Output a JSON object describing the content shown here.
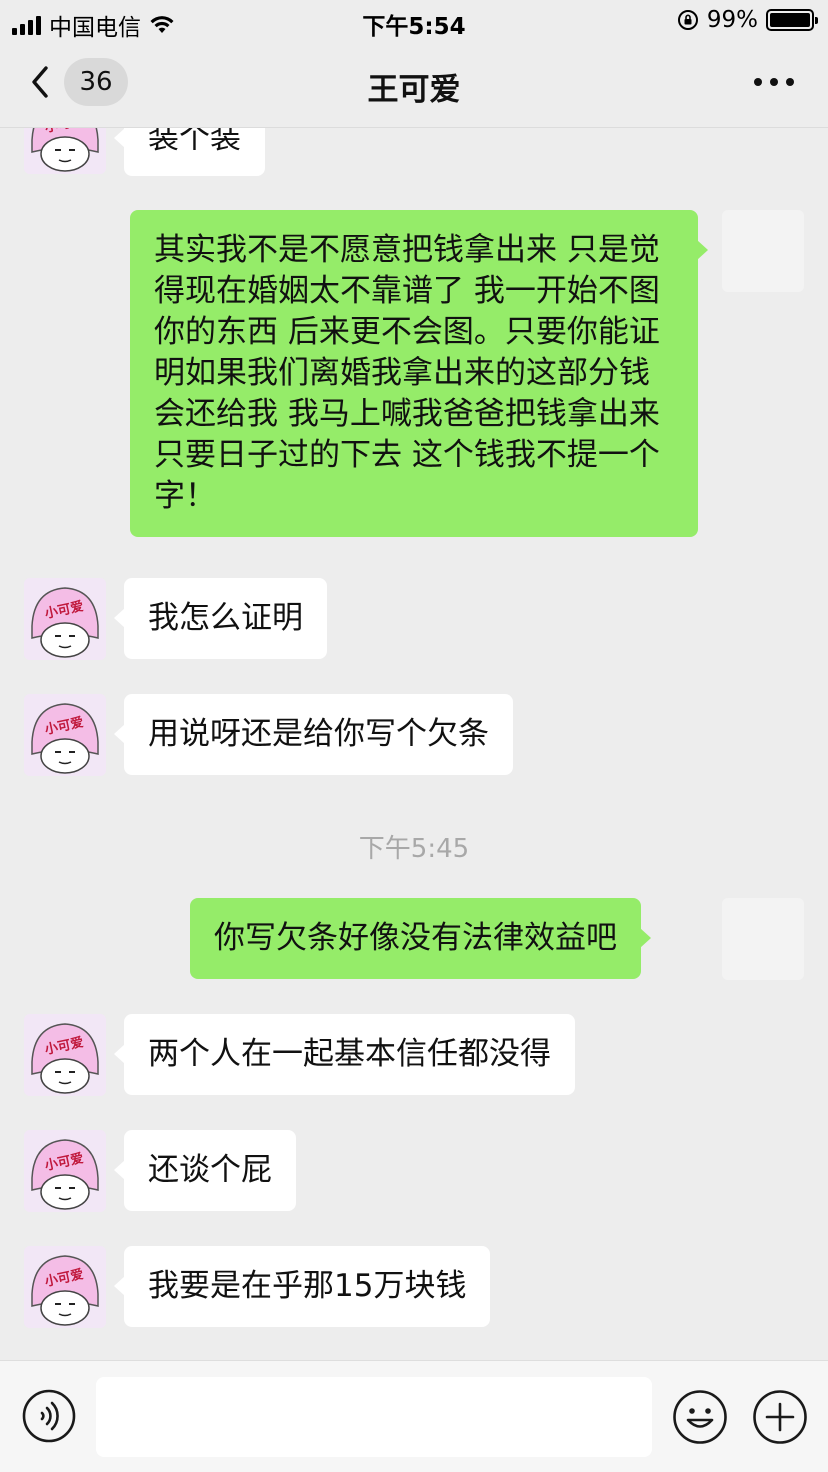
{
  "status_bar": {
    "carrier": "中国电信",
    "time": "下午5:54",
    "battery_percent": "99%",
    "battery_level": 0.99
  },
  "nav": {
    "back_count": "36",
    "title": "王可爱",
    "icons": {
      "back": "chevron-left-icon",
      "more": "more-dots-icon"
    }
  },
  "avatar_text": "小可爱",
  "messages": [
    {
      "side": "left",
      "text": "装个装"
    },
    {
      "side": "right",
      "text": "其实我不是不愿意把钱拿出来  只是觉得现在婚姻太不靠谱了  我一开始不图你的东西 后来更不会图。只要你能证明如果我们离婚我拿出来的这部分钱会还给我 我马上喊我爸爸把钱拿出来  只要日子过的下去 这个钱我不提一个字！"
    },
    {
      "side": "left",
      "text": "我怎么证明"
    },
    {
      "side": "left",
      "text": "用说呀还是给你写个欠条"
    },
    {
      "type": "time",
      "text": "下午5:45"
    },
    {
      "side": "right",
      "text": "你写欠条好像没有法律效益吧"
    },
    {
      "side": "left",
      "text": "两个人在一起基本信任都没得"
    },
    {
      "side": "left",
      "text": "还谈个屁"
    },
    {
      "side": "left",
      "text": "我要是在乎那15万块钱"
    }
  ],
  "input_bar": {
    "message_value": "",
    "icons": {
      "voice": "voice-icon",
      "emoji": "emoji-icon",
      "plus": "plus-icon"
    }
  },
  "colors": {
    "background": "#ededed",
    "bubble_self": "#95ec69",
    "bubble_other": "#ffffff",
    "timestamp": "#a8a8a8"
  }
}
